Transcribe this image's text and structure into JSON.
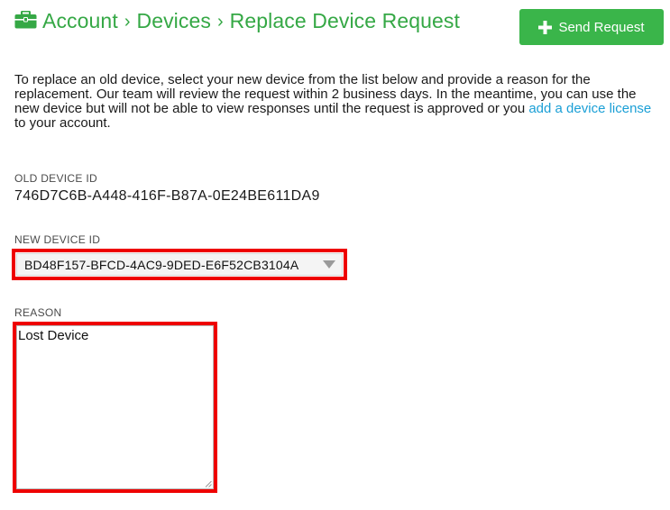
{
  "breadcrumb": {
    "items": [
      "Account",
      "Devices",
      "Replace Device Request"
    ],
    "separator": "›",
    "icon": "briefcase-icon"
  },
  "toolbar": {
    "send_label": "Send Request",
    "send_icon": "plus-icon"
  },
  "intro": {
    "text_before": "To replace an old device, select your new device from the list below and provide a reason for the replacement. Our team will review the request within 2 business days. In the meantime, you can use the new device but will not be able to view responses until the request is approved or you ",
    "link_text": "add a device license",
    "text_after": " to your account."
  },
  "old_device": {
    "label": "OLD DEVICE ID",
    "value": "746D7C6B-A448-416F-B87A-0E24BE611DA9"
  },
  "new_device": {
    "label": "NEW DEVICE ID",
    "selected": "BD48F157-BFCD-4AC9-9DED-E6F52CB3104A"
  },
  "reason": {
    "label": "REASON",
    "value": "Lost Device"
  },
  "colors": {
    "brand_green": "#35a845",
    "button_green": "#3ab54a",
    "link_blue": "#1a9fd6",
    "highlight_red": "#ee0000"
  }
}
